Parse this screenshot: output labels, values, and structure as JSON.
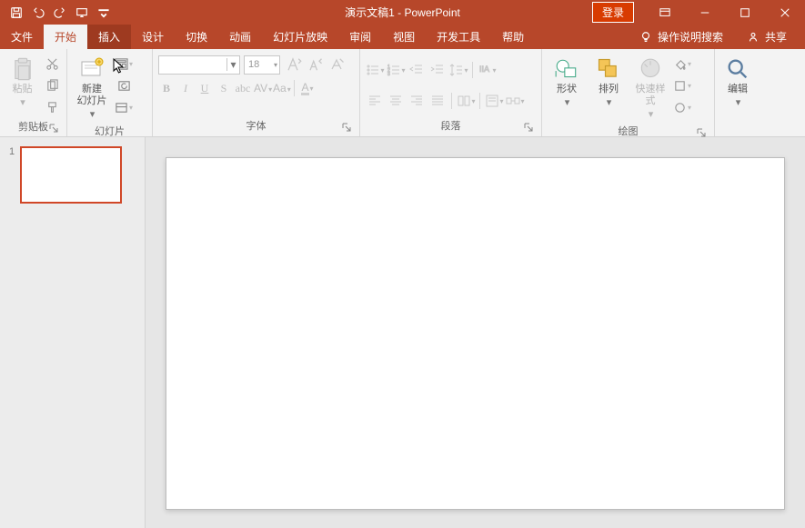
{
  "title": "演示文稿1  -  PowerPoint",
  "login": "登录",
  "share": "共享",
  "tellme": "操作说明搜索",
  "tabs": {
    "file": "文件",
    "home": "开始",
    "insert": "插入",
    "design": "设计",
    "transitions": "切换",
    "animations": "动画",
    "slideshow": "幻灯片放映",
    "review": "审阅",
    "view": "视图",
    "developer": "开发工具",
    "help": "帮助"
  },
  "groups": {
    "clipboard": {
      "label": "剪贴板",
      "paste": "粘贴"
    },
    "slides": {
      "label": "幻灯片",
      "newslide": "新建\n幻灯片"
    },
    "font": {
      "label": "字体",
      "size": "18",
      "bold": "B",
      "italic": "I",
      "underline": "U",
      "strike": "S",
      "spacing": "AV",
      "case": "Aa",
      "color": "A"
    },
    "paragraph": {
      "label": "段落"
    },
    "drawing": {
      "label": "绘图",
      "shapes": "形状",
      "arrange": "排列",
      "quickstyles": "快速样式"
    },
    "editing": {
      "label": "",
      "find": "编辑"
    }
  },
  "slidepanel": {
    "num": "1"
  }
}
